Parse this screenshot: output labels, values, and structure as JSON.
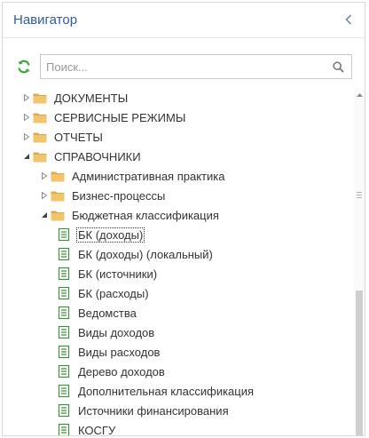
{
  "panel": {
    "title": "Навигатор"
  },
  "search": {
    "placeholder": "Поиск..."
  },
  "tree": [
    {
      "label": "ДОКУМЕНТЫ",
      "level": 0,
      "kind": "folder",
      "expanded": false
    },
    {
      "label": "СЕРВИСНЫЕ РЕЖИМЫ",
      "level": 0,
      "kind": "folder",
      "expanded": false
    },
    {
      "label": "ОТЧЕТЫ",
      "level": 0,
      "kind": "folder",
      "expanded": false
    },
    {
      "label": "СПРАВОЧНИКИ",
      "level": 0,
      "kind": "folder",
      "expanded": true
    },
    {
      "label": "Административная практика",
      "level": 1,
      "kind": "folder",
      "expanded": false
    },
    {
      "label": "Бизнес-процессы",
      "level": 1,
      "kind": "folder",
      "expanded": false
    },
    {
      "label": "Бюджетная классификация",
      "level": 1,
      "kind": "folder",
      "expanded": true
    },
    {
      "label": "БК (доходы)",
      "level": 2,
      "kind": "doc",
      "selected": true
    },
    {
      "label": "БК (доходы) (локальный)",
      "level": 2,
      "kind": "doc"
    },
    {
      "label": "БК (источники)",
      "level": 2,
      "kind": "doc"
    },
    {
      "label": "БК (расходы)",
      "level": 2,
      "kind": "doc"
    },
    {
      "label": "Ведомства",
      "level": 2,
      "kind": "doc"
    },
    {
      "label": "Виды доходов",
      "level": 2,
      "kind": "doc"
    },
    {
      "label": "Виды расходов",
      "level": 2,
      "kind": "doc"
    },
    {
      "label": "Дерево доходов",
      "level": 2,
      "kind": "doc"
    },
    {
      "label": "Дополнительная классификация",
      "level": 2,
      "kind": "doc"
    },
    {
      "label": "Источники финансирования",
      "level": 2,
      "kind": "doc"
    },
    {
      "label": "КОСГУ",
      "level": 2,
      "kind": "doc"
    }
  ],
  "colors": {
    "title": "#2d5d9f",
    "folder": "#f2c46c",
    "folder_dark": "#e0a84a",
    "doc_icon": "#3f8f3f",
    "refresh_icon": "#3aa33a"
  }
}
